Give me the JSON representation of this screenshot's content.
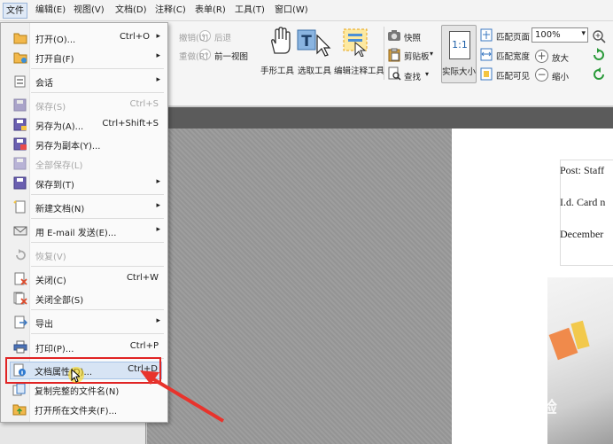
{
  "menubar": {
    "items": [
      "文件",
      "编辑(E)",
      "视图(V)",
      "文档(D)",
      "注释(C)",
      "表单(R)",
      "工具(T)",
      "窗口(W)"
    ]
  },
  "ribbon": {
    "undo": "撤销(U)",
    "back": "后退",
    "redo": "重做(R)",
    "forward": "前一视图",
    "hand_tool": "手形工具",
    "select_tool": "选取工具",
    "edit_annot_tool": "编辑注释工具",
    "snapshot": "快照",
    "clipboard": "剪贴板",
    "find": "查找",
    "actual_size": "实际大小",
    "actual_size_icon": "1:1",
    "fit_page": "匹配页面",
    "fit_width": "匹配宽度",
    "fit_visible": "匹配可见",
    "zoom_value": "100%",
    "zoom_in": "放大",
    "zoom_out": "缩小"
  },
  "file_menu": {
    "items": [
      {
        "label": "打开(O)...",
        "shortcut": "Ctrl+O",
        "arrow": "▸",
        "icon": "open-folder-icon"
      },
      {
        "label": "打开自(F)",
        "shortcut": "",
        "arrow": "▸",
        "icon": "open-from-icon"
      },
      {
        "label": "会话",
        "shortcut": "",
        "arrow": "▸",
        "icon": "session-icon"
      },
      {
        "label": "保存(S)",
        "shortcut": "Ctrl+S",
        "arrow": "",
        "icon": "save-icon"
      },
      {
        "label": "另存为(A)...",
        "shortcut": "Ctrl+Shift+S",
        "arrow": "",
        "icon": "save-as-icon"
      },
      {
        "label": "另存为副本(Y)...",
        "shortcut": "",
        "arrow": "",
        "icon": "save-copy-icon"
      },
      {
        "label": "全部保存(L)",
        "shortcut": "",
        "arrow": "",
        "icon": "save-all-icon"
      },
      {
        "label": "保存到(T)",
        "shortcut": "",
        "arrow": "▸",
        "icon": "save-to-icon"
      },
      {
        "label": "新建文档(N)",
        "shortcut": "",
        "arrow": "▸",
        "icon": "new-doc-icon"
      },
      {
        "label": "用 E-mail 发送(E)...",
        "shortcut": "",
        "arrow": "▸",
        "icon": "email-icon"
      },
      {
        "label": "恢复(V)",
        "shortcut": "",
        "arrow": "",
        "icon": "revert-icon"
      },
      {
        "label": "关闭(C)",
        "shortcut": "Ctrl+W",
        "arrow": "",
        "icon": "close-doc-icon"
      },
      {
        "label": "关闭全部(S)",
        "shortcut": "",
        "arrow": "",
        "icon": "close-all-icon"
      },
      {
        "label": "导出",
        "shortcut": "",
        "arrow": "▸",
        "icon": "export-icon"
      },
      {
        "label": "打印(P)...",
        "shortcut": "Ctrl+P",
        "arrow": "",
        "icon": "print-icon"
      },
      {
        "label": "文档属性(D)...",
        "shortcut": "Ctrl+D",
        "arrow": "",
        "icon": "doc-properties-icon"
      },
      {
        "label": "复制完整的文件名(N)",
        "shortcut": "",
        "arrow": "",
        "icon": "copy-filename-icon"
      },
      {
        "label": "打开所在文件夹(F)...",
        "shortcut": "",
        "arrow": "",
        "icon": "open-containing-folder-icon"
      }
    ]
  },
  "document": {
    "lines": [
      "Post: Staff",
      "I.d. Card n",
      "December"
    ]
  },
  "watermark": "Baidu经验"
}
